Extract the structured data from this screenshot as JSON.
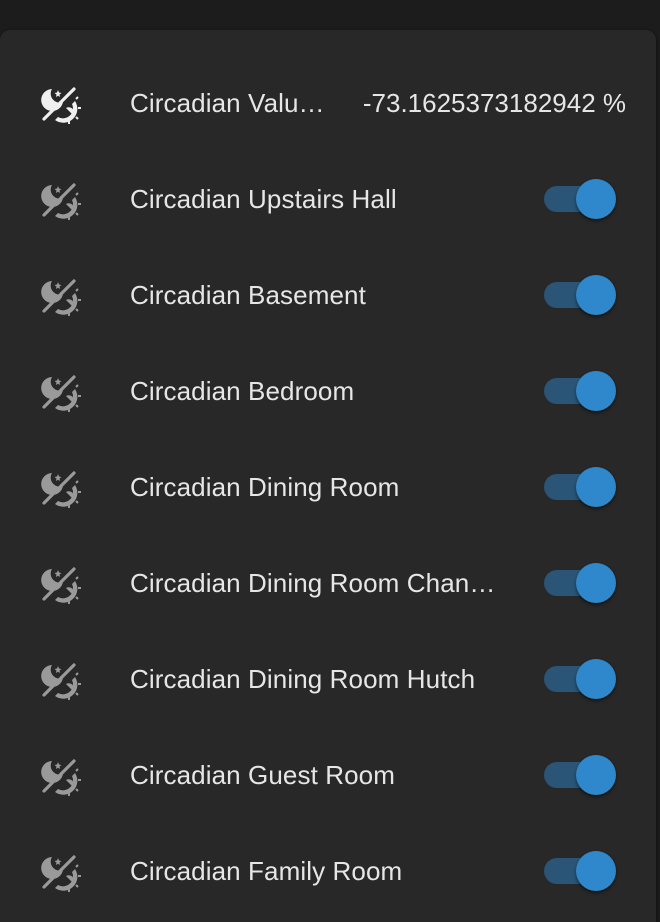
{
  "colors": {
    "background": "#1c1c1c",
    "card": "#282828",
    "text": "#e6e6e6",
    "icon_active": "#f0f0f0",
    "icon_inactive": "#9a9a9a",
    "switch_thumb": "#2f88cc",
    "switch_track": "#2a5577"
  },
  "entities": {
    "value_row": {
      "icon": "theme-light-dark-icon",
      "name": "Circadian Valu…",
      "value": "-73.1625373182942 %"
    },
    "switches": [
      {
        "icon": "theme-light-dark-icon",
        "name": "Circadian Upstairs Hall",
        "state": "on"
      },
      {
        "icon": "theme-light-dark-icon",
        "name": "Circadian Basement",
        "state": "on"
      },
      {
        "icon": "theme-light-dark-icon",
        "name": "Circadian Bedroom",
        "state": "on"
      },
      {
        "icon": "theme-light-dark-icon",
        "name": "Circadian Dining Room",
        "state": "on"
      },
      {
        "icon": "theme-light-dark-icon",
        "name": "Circadian Dining Room Chan…",
        "state": "on"
      },
      {
        "icon": "theme-light-dark-icon",
        "name": "Circadian Dining Room Hutch",
        "state": "on"
      },
      {
        "icon": "theme-light-dark-icon",
        "name": "Circadian Guest Room",
        "state": "on"
      },
      {
        "icon": "theme-light-dark-icon",
        "name": "Circadian Family Room",
        "state": "on"
      }
    ]
  }
}
